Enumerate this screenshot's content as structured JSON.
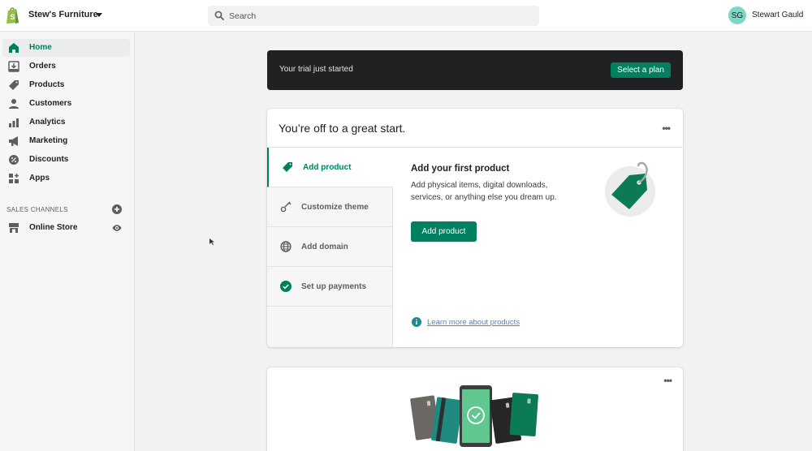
{
  "topbar": {
    "store_name": "Stew's Furniture",
    "search_placeholder": "Search",
    "user_initials": "SG",
    "user_name": "Stewart Gauld"
  },
  "sidebar": {
    "items": [
      {
        "label": "Home",
        "icon": "home-icon",
        "active": true
      },
      {
        "label": "Orders",
        "icon": "orders-icon"
      },
      {
        "label": "Products",
        "icon": "tag-icon"
      },
      {
        "label": "Customers",
        "icon": "person-icon"
      },
      {
        "label": "Analytics",
        "icon": "bar-chart-icon"
      },
      {
        "label": "Marketing",
        "icon": "megaphone-icon"
      },
      {
        "label": "Discounts",
        "icon": "discount-icon"
      },
      {
        "label": "Apps",
        "icon": "apps-icon"
      }
    ],
    "sales_channels_label": "SALES CHANNELS",
    "channels": [
      {
        "label": "Online Store",
        "icon": "store-icon"
      }
    ]
  },
  "trial_banner": {
    "text": "Your trial just started",
    "button_label": "Select a plan"
  },
  "setup_card": {
    "title": "You’re off to a great start.",
    "more_label": "•••",
    "steps": [
      {
        "label": "Add product",
        "icon": "tag-icon",
        "active": true
      },
      {
        "label": "Customize theme",
        "icon": "brush-icon"
      },
      {
        "label": "Add domain",
        "icon": "globe-icon"
      },
      {
        "label": "Set up payments",
        "icon": "check-circle-icon",
        "completed": true
      }
    ],
    "panel": {
      "title": "Add your first product",
      "description": "Add physical items, digital downloads, services, or anything else you dream up.",
      "button_label": "Add product",
      "learn_more_label": "Learn more about products"
    }
  },
  "payment_card": {
    "more_label": "•••"
  },
  "colors": {
    "brand_green": "#008060",
    "active_nav_text": "#007f5f",
    "banner_bg": "#202123",
    "avatar_bg": "#7ed6c5",
    "link_blue": "#2c6ecb"
  }
}
